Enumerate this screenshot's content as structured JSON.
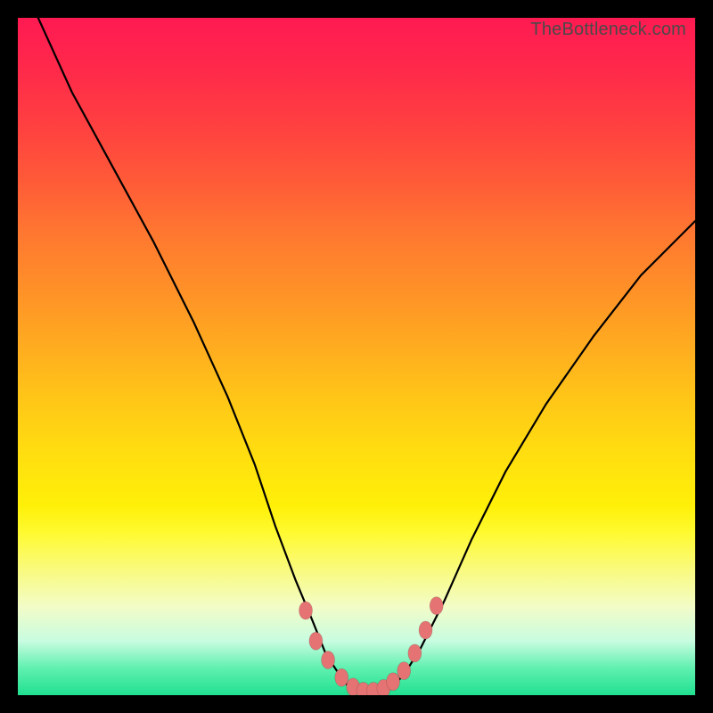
{
  "watermark": {
    "text": "TheBottleneck.com"
  },
  "colors": {
    "frame": "#000000",
    "curve": "#000000",
    "marker": "#e57373",
    "gradient_stops": [
      "#ff1a52",
      "#ff2a4a",
      "#ff4040",
      "#ff5a38",
      "#ff7830",
      "#ff9028",
      "#ffaa20",
      "#ffc518",
      "#ffdd10",
      "#fff008",
      "#fffa30",
      "#fafa78",
      "#f2fcc8",
      "#c8fce0",
      "#60f0b0",
      "#20e090"
    ]
  },
  "chart_data": {
    "type": "line",
    "title": "",
    "xlabel": "",
    "ylabel": "",
    "xlim": [
      0,
      100
    ],
    "ylim": [
      0,
      100
    ],
    "grid": false,
    "legend": false,
    "series": [
      {
        "name": "bottleneck-curve",
        "x": [
          3,
          8,
          14,
          20,
          26,
          31,
          35,
          38,
          41,
          43.5,
          45.5,
          47.5,
          49,
          51,
          53,
          55,
          57,
          59.5,
          63,
          67,
          72,
          78,
          85,
          92,
          100
        ],
        "y": [
          100,
          89,
          78,
          67,
          55,
          44,
          34,
          25,
          17,
          11,
          6,
          3,
          1,
          0.5,
          0.5,
          1,
          3,
          7,
          14,
          23,
          33,
          43,
          53,
          62,
          70
        ]
      }
    ],
    "markers": [
      {
        "x": 42.5,
        "y": 12.5
      },
      {
        "x": 44.0,
        "y": 8.0
      },
      {
        "x": 45.8,
        "y": 5.2
      },
      {
        "x": 47.8,
        "y": 2.6
      },
      {
        "x": 49.5,
        "y": 1.2
      },
      {
        "x": 51.0,
        "y": 0.6
      },
      {
        "x": 52.5,
        "y": 0.6
      },
      {
        "x": 54.0,
        "y": 1.0
      },
      {
        "x": 55.4,
        "y": 2.0
      },
      {
        "x": 57.0,
        "y": 3.6
      },
      {
        "x": 58.6,
        "y": 6.2
      },
      {
        "x": 60.2,
        "y": 9.6
      },
      {
        "x": 61.8,
        "y": 13.2
      }
    ]
  }
}
